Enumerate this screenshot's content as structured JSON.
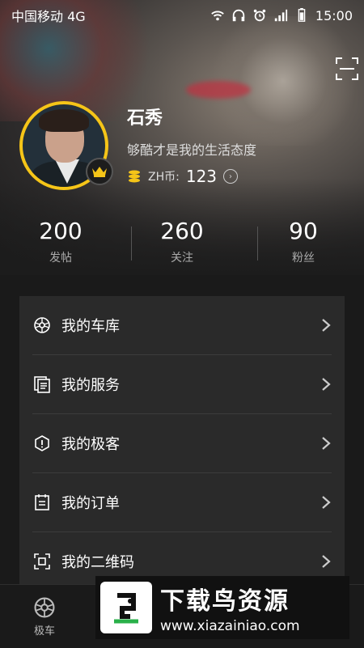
{
  "status": {
    "carrier": "中国移动 4G",
    "time": "15:00"
  },
  "profile": {
    "name": "石秀",
    "motto": "够酷才是我的生活态度",
    "coin_label": "ZH币:",
    "coin_value": "123"
  },
  "stats": [
    {
      "value": "200",
      "label": "发帖"
    },
    {
      "value": "260",
      "label": "关注"
    },
    {
      "value": "90",
      "label": "粉丝"
    }
  ],
  "menu": [
    {
      "label": "我的车库",
      "icon": "wheel-icon"
    },
    {
      "label": "我的服务",
      "icon": "document-icon"
    },
    {
      "label": "我的极客",
      "icon": "hexagon-info-icon"
    },
    {
      "label": "我的订单",
      "icon": "list-icon"
    },
    {
      "label": "我的二维码",
      "icon": "qr-code-icon"
    }
  ],
  "tabbar": {
    "tab1_label": "极车"
  },
  "watermark": {
    "title": "下载鸟资源",
    "url": "www.xiazainiao.com"
  },
  "colors": {
    "accent": "#f5c518",
    "card": "#2a2a2a",
    "background": "#1a1a1a"
  }
}
